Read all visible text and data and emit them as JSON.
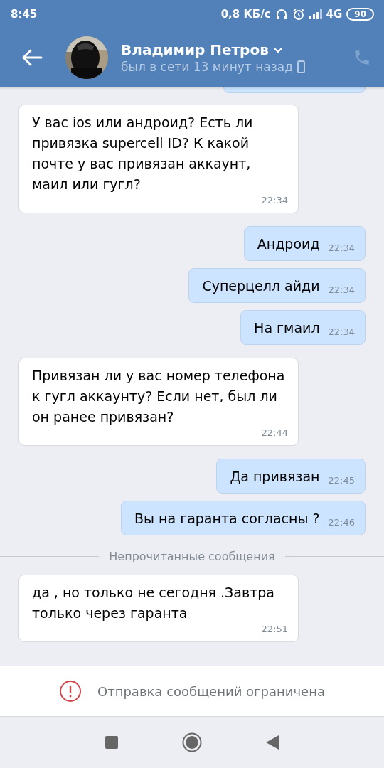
{
  "status_bar": {
    "time": "8:45",
    "speed": "0,8 КБ/с",
    "network": "4G",
    "battery": "90"
  },
  "header": {
    "name": "Владимир Петров",
    "status": "был в сети 13 минут назад"
  },
  "messages": [
    {
      "kind": "stub",
      "outgoing": true
    },
    {
      "kind": "message",
      "outgoing": false,
      "text": "У вас ios или андроид? Есть ли привязка supercell ID? К какой почте у вас привязан аккаунт, маил или гугл?",
      "time": "22:34"
    },
    {
      "kind": "message",
      "outgoing": true,
      "text": "Андроид",
      "time": "22:34"
    },
    {
      "kind": "message",
      "outgoing": true,
      "text": "Суперцелл айди",
      "time": "22:34"
    },
    {
      "kind": "message",
      "outgoing": true,
      "text": "На гмаил",
      "time": "22:34"
    },
    {
      "kind": "message",
      "outgoing": false,
      "text": "Привязан ли у вас номер телефона к гугл аккаунту? Если нет, был ли он ранее привязан?",
      "time": "22:44"
    },
    {
      "kind": "message",
      "outgoing": true,
      "text": "Да привязан",
      "time": "22:45"
    },
    {
      "kind": "message",
      "outgoing": true,
      "text": "Вы на гаранта согласны ?",
      "time": "22:46"
    },
    {
      "kind": "divider",
      "text": "Непрочитанные сообщения"
    },
    {
      "kind": "message",
      "outgoing": false,
      "text": "да , но только не сегодня .Завтра только через гаранта",
      "time": "22:51"
    }
  ],
  "notice": {
    "text": "Отправка сообщений ограничена"
  }
}
